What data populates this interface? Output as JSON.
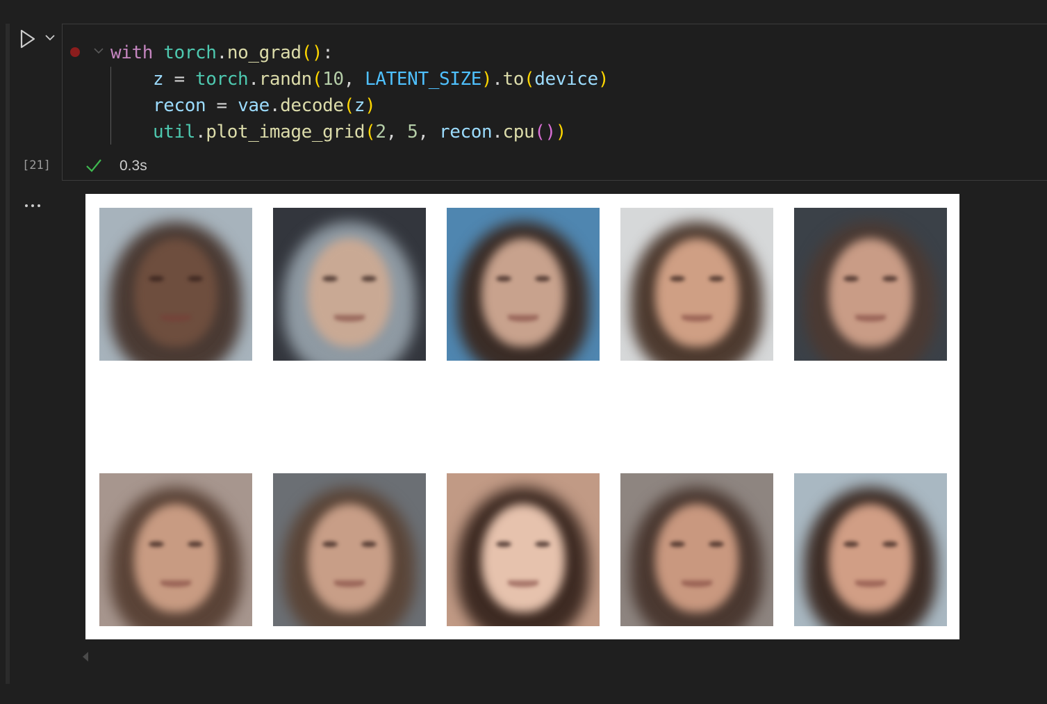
{
  "cell": {
    "execution_count": "[21]",
    "status": "success",
    "duration": "0.3s",
    "code_lines": [
      [
        {
          "t": "with",
          "c": "kw"
        },
        {
          "t": " ",
          "c": "op"
        },
        {
          "t": "torch",
          "c": "fn"
        },
        {
          "t": ".",
          "c": "op"
        },
        {
          "t": "no_grad",
          "c": "mt"
        },
        {
          "t": "()",
          "c": "p1"
        },
        {
          "t": ":",
          "c": "op"
        }
      ],
      [
        {
          "t": "    ",
          "c": "op"
        },
        {
          "t": "z",
          "c": "vr"
        },
        {
          "t": " = ",
          "c": "op"
        },
        {
          "t": "torch",
          "c": "fn"
        },
        {
          "t": ".",
          "c": "op"
        },
        {
          "t": "randn",
          "c": "mt"
        },
        {
          "t": "(",
          "c": "p1"
        },
        {
          "t": "10",
          "c": "nm"
        },
        {
          "t": ", ",
          "c": "op"
        },
        {
          "t": "LATENT_SIZE",
          "c": "cn"
        },
        {
          "t": ")",
          "c": "p1"
        },
        {
          "t": ".",
          "c": "op"
        },
        {
          "t": "to",
          "c": "mt"
        },
        {
          "t": "(",
          "c": "p1"
        },
        {
          "t": "device",
          "c": "vr"
        },
        {
          "t": ")",
          "c": "p1"
        }
      ],
      [
        {
          "t": "    ",
          "c": "op"
        },
        {
          "t": "recon",
          "c": "vr"
        },
        {
          "t": " = ",
          "c": "op"
        },
        {
          "t": "vae",
          "c": "vr"
        },
        {
          "t": ".",
          "c": "op"
        },
        {
          "t": "decode",
          "c": "mt"
        },
        {
          "t": "(",
          "c": "p1"
        },
        {
          "t": "z",
          "c": "vr"
        },
        {
          "t": ")",
          "c": "p1"
        }
      ],
      [
        {
          "t": "    ",
          "c": "op"
        },
        {
          "t": "util",
          "c": "fn"
        },
        {
          "t": ".",
          "c": "op"
        },
        {
          "t": "plot_image_grid",
          "c": "mt"
        },
        {
          "t": "(",
          "c": "p1"
        },
        {
          "t": "2",
          "c": "nm"
        },
        {
          "t": ", ",
          "c": "op"
        },
        {
          "t": "5",
          "c": "nm"
        },
        {
          "t": ", ",
          "c": "op"
        },
        {
          "t": "recon",
          "c": "vr"
        },
        {
          "t": ".",
          "c": "op"
        },
        {
          "t": "cpu",
          "c": "mt"
        },
        {
          "t": "()",
          "c": "p2"
        },
        {
          "t": ")",
          "c": "p1"
        }
      ]
    ]
  },
  "icons": {
    "run": "play-icon",
    "run_menu": "chevron-down-icon",
    "breakpoint": "breakpoint-icon",
    "fold": "fold-chevron-icon",
    "status": "checkmark-icon",
    "output_menu": "more-actions-icon",
    "scroll": "scroll-left-icon"
  },
  "output": {
    "grid_rows": 2,
    "grid_cols": 5,
    "images": [
      {
        "bg": "#a7b3bc",
        "hair": "#4a3a33",
        "skin": "#6e4e3e"
      },
      {
        "bg": "#33363d",
        "hair": "#8f9aa3",
        "skin": "#c9a994"
      },
      {
        "bg": "#4f86b0",
        "hair": "#3a2c26",
        "skin": "#c8a28d"
      },
      {
        "bg": "#d6d8d9",
        "hair": "#4d3a2f",
        "skin": "#cf9f84"
      },
      {
        "bg": "#3b4148",
        "hair": "#4b3a33",
        "skin": "#c99c86"
      },
      {
        "bg": "#a7968e",
        "hair": "#5a4337",
        "skin": "#c89b82"
      },
      {
        "bg": "#6b6f74",
        "hair": "#5a4538",
        "skin": "#c89e87"
      },
      {
        "bg": "#c19a85",
        "hair": "#3d2a22",
        "skin": "#e6c2ad"
      },
      {
        "bg": "#8e8580",
        "hair": "#4a3830",
        "skin": "#c9987f"
      },
      {
        "bg": "#a9b8c2",
        "hair": "#3d2d26",
        "skin": "#d19e85"
      }
    ]
  }
}
